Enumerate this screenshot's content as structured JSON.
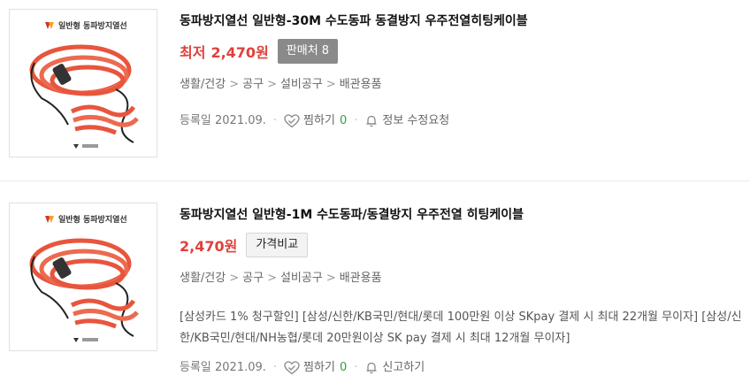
{
  "products": [
    {
      "title": "동파방지열선 일반형-30M 수도동파 동결방지 우주전열히팅케이블",
      "price_label": "최저",
      "price": "2,470원",
      "badge": "판매처 8",
      "categories": [
        "생활/건강",
        "공구",
        "설비공구",
        "배관용품"
      ],
      "registered": "등록일 2021.09.",
      "wishlist_label": "찜하기",
      "wishlist_count": "0",
      "extra_action": "정보 수정요청",
      "thumb_header": "일반형 동파방지열선"
    },
    {
      "title": "동파방지열선 일반형-1M 수도동파/동결방지 우주전열 히팅케이블",
      "price": "2,470원",
      "badge": "가격비교",
      "categories": [
        "생활/건강",
        "공구",
        "설비공구",
        "배관용품"
      ],
      "promo": "[삼성카드 1% 청구할인] [삼성/신한/KB국민/현대/롯데 100만원 이상 SKpay 결제 시 최대 22개월 무이자] [삼성/신한/KB국민/현대/NH농협/롯데 20만원이상 SK pay 결제 시 최대 12개월 무이자]",
      "registered": "등록일 2021.09.",
      "wishlist_label": "찜하기",
      "wishlist_count": "0",
      "extra_action": "신고하기",
      "thumb_header": "일반형 동파방지열선"
    }
  ],
  "colors": {
    "price": "#e0403a",
    "wish_count": "#2ca33f",
    "cable": "#e8553d"
  }
}
